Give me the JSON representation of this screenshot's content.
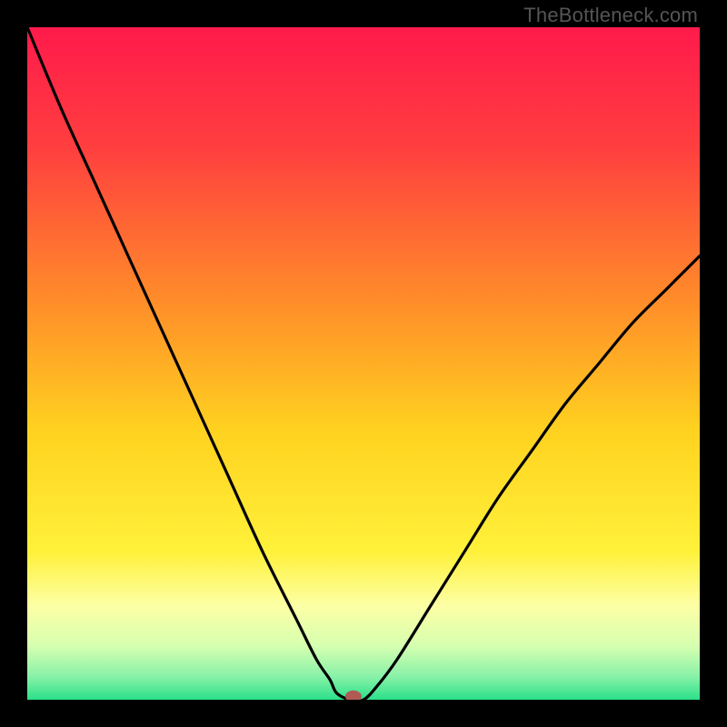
{
  "watermark": "TheBottleneck.com",
  "chart_data": {
    "type": "line",
    "title": "",
    "xlabel": "",
    "ylabel": "",
    "xlim": [
      0,
      100
    ],
    "ylim": [
      0,
      100
    ],
    "series": [
      {
        "name": "curve",
        "x": [
          0,
          5,
          10,
          15,
          20,
          25,
          30,
          35,
          40,
          43,
          45,
          46,
          48,
          50,
          52,
          55,
          60,
          65,
          70,
          75,
          80,
          85,
          90,
          95,
          100
        ],
        "y": [
          100,
          88,
          77,
          66,
          55,
          44,
          33,
          22,
          12,
          6,
          3,
          1,
          0,
          0,
          2,
          6,
          14,
          22,
          30,
          37,
          44,
          50,
          56,
          61,
          66
        ]
      }
    ],
    "marker": {
      "x": 48.5,
      "y": 0.5,
      "color": "#b05a55"
    },
    "background_gradient": {
      "stops": [
        {
          "offset": 0.0,
          "color": "#ff1a4b"
        },
        {
          "offset": 0.18,
          "color": "#ff3f3f"
        },
        {
          "offset": 0.4,
          "color": "#ff8a2a"
        },
        {
          "offset": 0.6,
          "color": "#ffd21f"
        },
        {
          "offset": 0.78,
          "color": "#fff13a"
        },
        {
          "offset": 0.86,
          "color": "#fdffa5"
        },
        {
          "offset": 0.92,
          "color": "#d6ffb0"
        },
        {
          "offset": 0.965,
          "color": "#89f2a8"
        },
        {
          "offset": 1.0,
          "color": "#2be08a"
        }
      ]
    }
  }
}
